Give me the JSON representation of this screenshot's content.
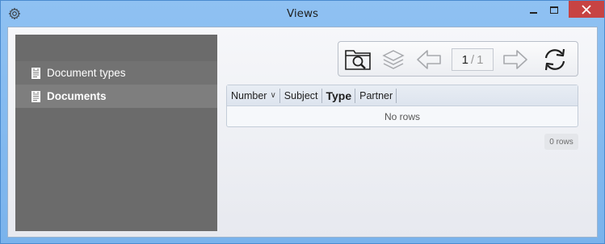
{
  "window": {
    "title": "Views",
    "settings_icon": "gear-icon",
    "close_color": "#c74343"
  },
  "sidebar": {
    "items": [
      {
        "label": "Document types",
        "icon": "document-icon"
      },
      {
        "label": "Documents",
        "icon": "document-icon",
        "selected": true
      }
    ]
  },
  "toolbar": {
    "icons": [
      "folder-search-icon",
      "layers-icon",
      "arrow-left-icon",
      "arrow-right-icon",
      "refresh-icon"
    ],
    "page_current": "1",
    "page_separator": "/",
    "page_total": "1"
  },
  "grid": {
    "columns": [
      {
        "label": "Number",
        "sort": "descending"
      },
      {
        "label": "Subject"
      },
      {
        "label": "Type",
        "active": true
      },
      {
        "label": "Partner"
      }
    ],
    "empty_text": "No rows",
    "row_count": "0 rows"
  }
}
